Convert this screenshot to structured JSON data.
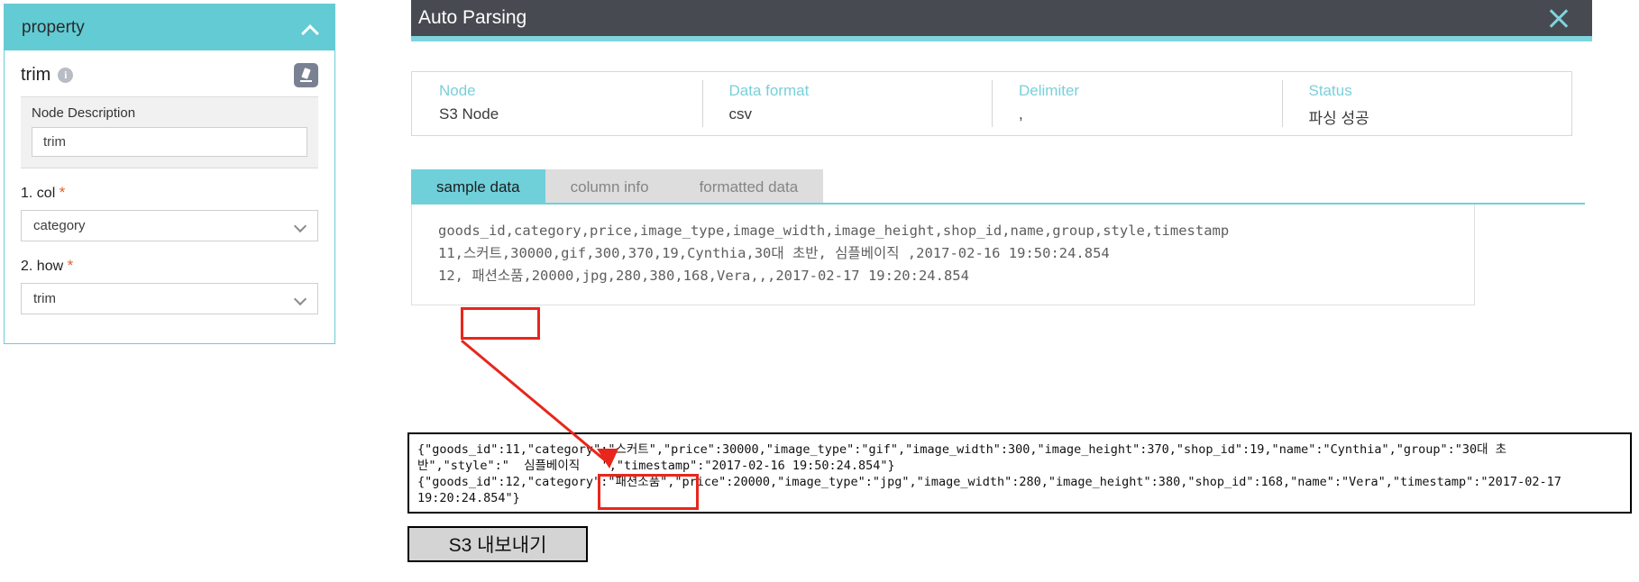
{
  "property_panel": {
    "header_title": "property",
    "collapse_icon": "chevron-up-icon",
    "node_name": "trim",
    "info_icon": "info-icon",
    "edit_icon": "pencil-edit-icon",
    "description_label": "Node Description",
    "description_value": "trim",
    "fields": [
      {
        "label": "1. col",
        "required": "*",
        "value": "category",
        "caret": "chevron-down-icon"
      },
      {
        "label": "2. how",
        "required": "*",
        "value": "trim",
        "caret": "chevron-down-icon"
      }
    ],
    "accent_color": "#62cbd4"
  },
  "modal": {
    "title": "Auto Parsing",
    "close_icon": "close-icon",
    "header_bg": "#474a51",
    "accent_color": "#7fd4dd",
    "info": [
      {
        "key": "Node",
        "value": "S3 Node"
      },
      {
        "key": "Data format",
        "value": "csv"
      },
      {
        "key": "Delimiter",
        "value": ","
      },
      {
        "key": "Status",
        "value": "파싱 성공"
      }
    ],
    "tabs": [
      {
        "label": "sample data",
        "active": true
      },
      {
        "label": "column info",
        "active": false
      },
      {
        "label": "formatted data",
        "active": false
      }
    ],
    "sample_data_lines": [
      "goods_id,category,price,image_type,image_width,image_height,shop_id,name,group,style,timestamp",
      "11,스커트,30000,gif,300,370,19,Cynthia,30대 초반, 심플베이직 ,2017-02-16 19:50:24.854",
      "12, 패션소품,20000,jpg,280,380,168,Vera,,,2017-02-17 19:20:24.854"
    ]
  },
  "json_output": {
    "lines": [
      "{\"goods_id\":11,\"category\":\"스커트\",\"price\":30000,\"image_type\":\"gif\",\"image_width\":300,\"image_height\":370,\"shop_id\":19,\"name\":\"Cynthia\",\"group\":\"30대 초",
      "반\",\"style\":\"  심플베이직   \",\"timestamp\":\"2017-02-16 19:50:24.854\"}",
      "{\"goods_id\":12,\"category\":\"패션소품\",\"price\":20000,\"image_type\":\"jpg\",\"image_width\":280,\"image_height\":380,\"shop_id\":168,\"name\":\"Vera\",\"timestamp\":\"2017-02-17",
      "19:20:24.854\"}"
    ],
    "export_label": "S3 내보내기"
  },
  "annotations": {
    "highlight_color": "#e8261b",
    "csv_highlight_text": "12, 패션소품,",
    "json_highlight_text": "\":\"패션소품\",\"",
    "arrow": "red-arrow-from-csv-to-json"
  }
}
